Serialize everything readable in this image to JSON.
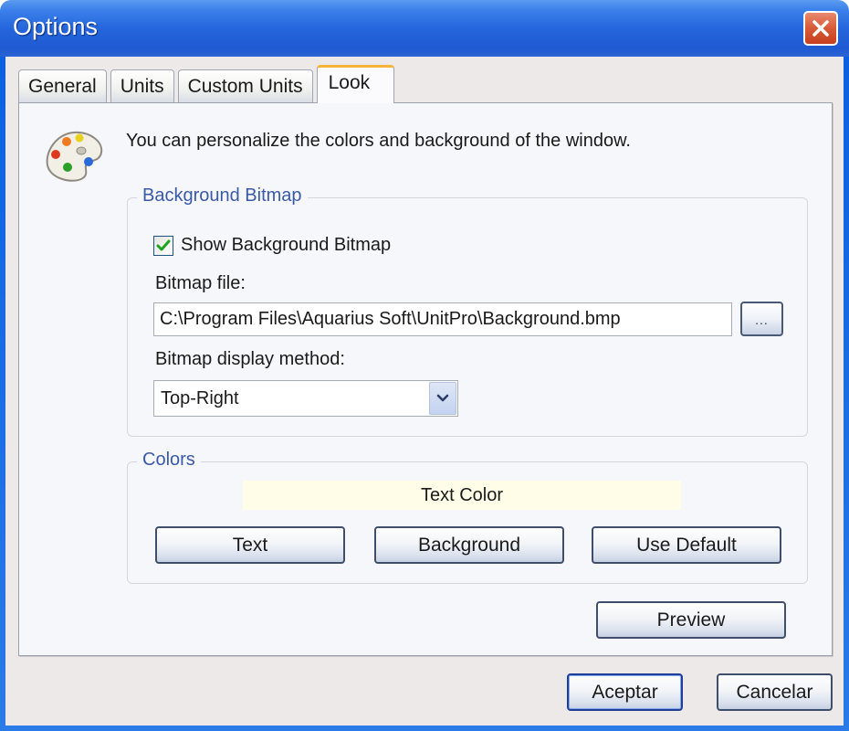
{
  "window": {
    "title": "Options",
    "close_icon": "close-icon"
  },
  "tabs": [
    {
      "label": "General",
      "active": false
    },
    {
      "label": "Units",
      "active": false
    },
    {
      "label": "Custom Units",
      "active": false
    },
    {
      "label": "Look",
      "active": true
    }
  ],
  "look": {
    "icon": "palette-icon",
    "intro": "You can personalize the colors and background of the window.",
    "background_bitmap": {
      "legend": "Background Bitmap",
      "show_checkbox": {
        "label": "Show Background Bitmap",
        "checked": true
      },
      "file_label": "Bitmap file:",
      "file_value": "C:\\Program Files\\Aquarius Soft\\UnitPro\\Background.bmp",
      "browse_label": "...",
      "method_label": "Bitmap display method:",
      "method_selected": "Top-Right"
    },
    "colors": {
      "legend": "Colors",
      "preview_text": "Text Color",
      "preview_bg": "#fffde8",
      "buttons": {
        "text": "Text",
        "background": "Background",
        "use_default": "Use Default"
      }
    },
    "preview_button": "Preview"
  },
  "footer": {
    "ok_label": "Aceptar",
    "cancel_label": "Cancelar"
  }
}
